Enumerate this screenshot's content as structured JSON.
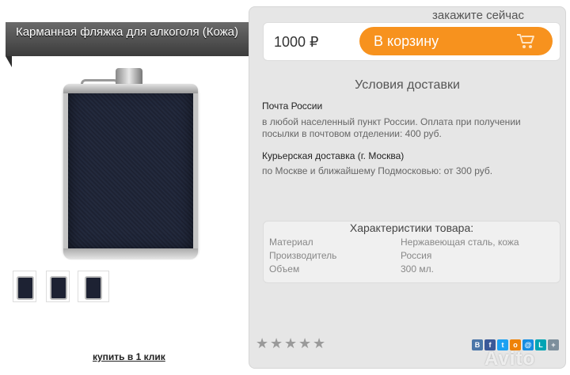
{
  "product": {
    "title": "Карманная фляжка для алкоголя (Кожа)",
    "buy_one_click": "купить в 1 клик"
  },
  "order": {
    "order_now": "закажите сейчас",
    "price": "1000 ₽",
    "cart_button": "В корзину"
  },
  "delivery": {
    "heading": "Условия доставки",
    "methods": [
      {
        "title": "Почта России",
        "text": "в любой населенный пункт России. Оплата при получении посылки в почтовом отделении: 400 руб."
      },
      {
        "title": "Курьерская доставка (г. Москва)",
        "text": "по Москве и ближайшему Подмосковью: от 300 руб."
      }
    ]
  },
  "specs": {
    "heading": "Характеристики товара:",
    "rows": [
      {
        "label": "Материал",
        "value": "Нержавеющая сталь, кожа"
      },
      {
        "label": "Производитель",
        "value": "Россия"
      },
      {
        "label": "Объем",
        "value": "300 мл."
      }
    ]
  },
  "rating": {
    "stars": 5,
    "filled": 0
  },
  "share_icons": [
    {
      "name": "vk-icon",
      "letter": "B",
      "color": "#4a76a8"
    },
    {
      "name": "facebook-icon",
      "letter": "f",
      "color": "#3b5998"
    },
    {
      "name": "twitter-icon",
      "letter": "t",
      "color": "#1da1f2"
    },
    {
      "name": "odnoklassniki-icon",
      "letter": "o",
      "color": "#ee8208"
    },
    {
      "name": "mail-icon",
      "letter": "@",
      "color": "#168de2"
    },
    {
      "name": "livejournal-icon",
      "letter": "L",
      "color": "#00a4b4"
    },
    {
      "name": "more-icon",
      "letter": "+",
      "color": "#7d8f9c"
    }
  ],
  "colors": {
    "accent": "#f7921e",
    "panel": "#e6e6e6"
  },
  "watermark": "Avito"
}
